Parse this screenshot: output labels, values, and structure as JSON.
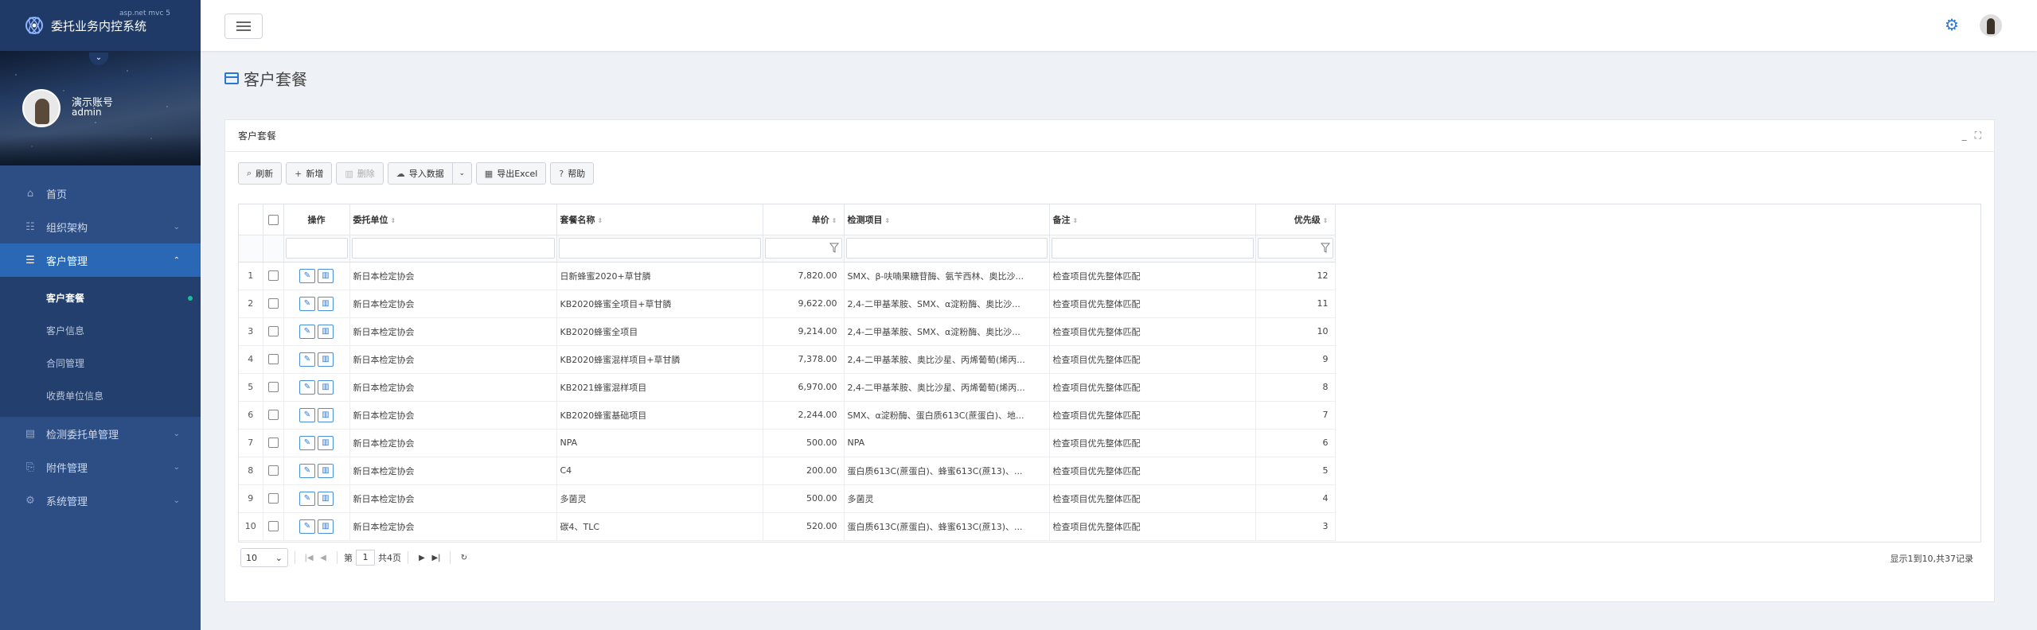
{
  "app": {
    "title": "委托业务内控系统",
    "subtitle": "asp.net mvc 5"
  },
  "profile": {
    "name": "演示账号",
    "role": "admin"
  },
  "menu": {
    "home": "首页",
    "org": "组织架构",
    "customer": "客户管理",
    "customer_subs": [
      "客户套餐",
      "客户信息",
      "合同管理",
      "收费单位信息"
    ],
    "inspection": "检测委托单管理",
    "attachment": "附件管理",
    "system": "系统管理"
  },
  "page": {
    "title": "客户套餐",
    "card_title": "客户套餐"
  },
  "toolbar": {
    "refresh": "刷新",
    "add": "新增",
    "delete": "删除",
    "import": "导入数据",
    "export": "导出Excel",
    "help": "帮助"
  },
  "grid": {
    "columns": {
      "op": "操作",
      "unit": "委托单位",
      "name": "套餐名称",
      "price": "单价",
      "items": "检测项目",
      "remark": "备注",
      "priority": "优先级"
    },
    "rows": [
      {
        "no": "1",
        "unit": "新日本检定协会",
        "name": "日新蜂蜜2020+草甘膦",
        "price": "7,820.00",
        "items": "SMX、β-呋喃果糖苷酶、氨苄西林、奥比沙...",
        "remark": "检查项目优先整体匹配",
        "priority": "12"
      },
      {
        "no": "2",
        "unit": "新日本检定协会",
        "name": "KB2020蜂蜜全项目+草甘膦",
        "price": "9,622.00",
        "items": "2,4-二甲基苯胺、SMX、α淀粉酶、奥比沙...",
        "remark": "检查项目优先整体匹配",
        "priority": "11"
      },
      {
        "no": "3",
        "unit": "新日本检定协会",
        "name": "KB2020蜂蜜全项目",
        "price": "9,214.00",
        "items": "2,4-二甲基苯胺、SMX、α淀粉酶、奥比沙...",
        "remark": "检查项目优先整体匹配",
        "priority": "10"
      },
      {
        "no": "4",
        "unit": "新日本检定协会",
        "name": "KB2020蜂蜜混样项目+草甘膦",
        "price": "7,378.00",
        "items": "2,4-二甲基苯胺、奥比沙星、丙烯葡萄(烯丙...",
        "remark": "检查项目优先整体匹配",
        "priority": "9"
      },
      {
        "no": "5",
        "unit": "新日本检定协会",
        "name": "KB2021蜂蜜混样项目",
        "price": "6,970.00",
        "items": "2,4-二甲基苯胺、奥比沙星、丙烯葡萄(烯丙...",
        "remark": "检查项目优先整体匹配",
        "priority": "8"
      },
      {
        "no": "6",
        "unit": "新日本检定协会",
        "name": "KB2020蜂蜜基础项目",
        "price": "2,244.00",
        "items": "SMX、α淀粉酶、蛋白质613C(蔗蛋白)、地...",
        "remark": "检查项目优先整体匹配",
        "priority": "7"
      },
      {
        "no": "7",
        "unit": "新日本检定协会",
        "name": "NPA",
        "price": "500.00",
        "items": "NPA",
        "remark": "检查项目优先整体匹配",
        "priority": "6"
      },
      {
        "no": "8",
        "unit": "新日本检定协会",
        "name": "C4",
        "price": "200.00",
        "items": "蛋白质613C(蔗蛋白)、蜂蜜613C(蔗13)、...",
        "remark": "检查项目优先整体匹配",
        "priority": "5"
      },
      {
        "no": "9",
        "unit": "新日本检定协会",
        "name": "多菌灵",
        "price": "500.00",
        "items": "多菌灵",
        "remark": "检查项目优先整体匹配",
        "priority": "4"
      },
      {
        "no": "10",
        "unit": "新日本检定协会",
        "name": "碳4、TLC",
        "price": "520.00",
        "items": "蛋白质613C(蔗蛋白)、蜂蜜613C(蔗13)、...",
        "remark": "检查项目优先整体匹配",
        "priority": "3"
      }
    ]
  },
  "pager": {
    "page_size": "10",
    "page_prefix": "第",
    "current_page": "1",
    "page_suffix": "共4页",
    "info": "显示1到10,共37记录"
  },
  "colors": {
    "sidebar": "#2c4e84",
    "sidebar_active": "#2a67b5",
    "accent": "#2a78d6",
    "dot": "#1ebc9b"
  }
}
